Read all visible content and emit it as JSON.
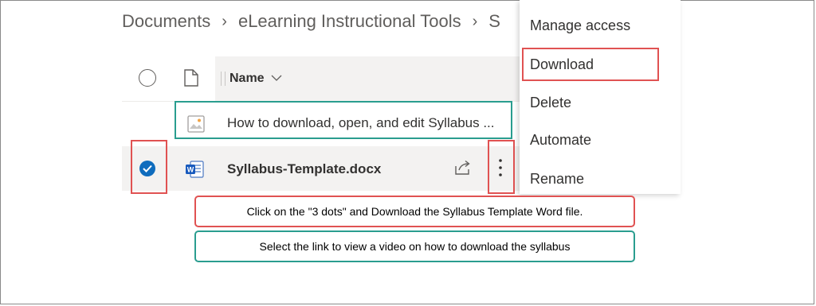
{
  "breadcrumb": {
    "items": [
      "Documents",
      "eLearning Instructional Tools",
      "S"
    ]
  },
  "list": {
    "column_name": "Name",
    "rows": [
      {
        "name": "How to download, open, and edit Syllabus ...",
        "icon": "image-file-icon",
        "selected": false
      },
      {
        "name": "Syllabus-Template.docx",
        "icon": "word-file-icon",
        "selected": true
      }
    ]
  },
  "menu": {
    "items": [
      "Manage access",
      "Download",
      "Delete",
      "Automate",
      "Rename"
    ]
  },
  "callouts": {
    "dots": "Click on the \"3 dots\" and Download the Syllabus Template Word file.",
    "link": "Select the link to view a video on how to download the syllabus"
  },
  "colors": {
    "highlight_red": "#e05252",
    "highlight_teal": "#2a9d8f",
    "selection_blue": "#0f6cbd",
    "row_selected_bg": "#f3f2f1"
  }
}
